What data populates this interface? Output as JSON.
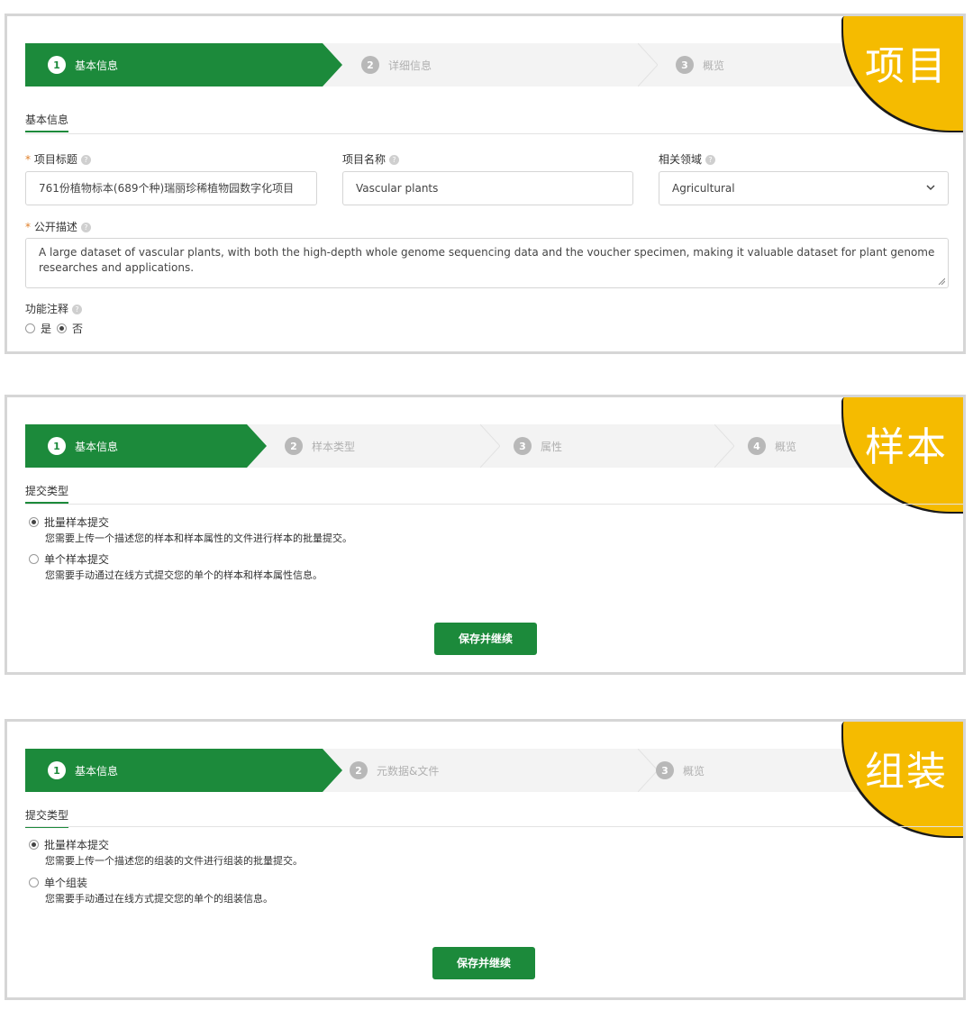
{
  "project": {
    "badge": "项目",
    "steps": [
      {
        "num": "1",
        "label": "基本信息"
      },
      {
        "num": "2",
        "label": "详细信息"
      },
      {
        "num": "3",
        "label": "概览"
      }
    ],
    "section_tab": "基本信息",
    "fields": {
      "title_label": "项目标题",
      "title_value": "761份植物标本(689个种)瑞丽珍稀植物园数字化项目",
      "name_label": "项目名称",
      "name_value": "Vascular plants",
      "domain_label": "相关领域",
      "domain_value": "Agricultural",
      "desc_label": "公开描述",
      "desc_value": "A large dataset of vascular plants, with both the high-depth whole genome sequencing data and the voucher specimen, making it valuable dataset for plant genome researches and applications.",
      "annotation_label": "功能注释",
      "annotation_yes": "是",
      "annotation_no": "否"
    }
  },
  "sample": {
    "badge": "样本",
    "steps": [
      {
        "num": "1",
        "label": "基本信息"
      },
      {
        "num": "2",
        "label": "样本类型"
      },
      {
        "num": "3",
        "label": "属性"
      },
      {
        "num": "4",
        "label": "概览"
      }
    ],
    "section_tab": "提交类型",
    "options": [
      {
        "title": "批量样本提交",
        "desc": "您需要上传一个描述您的样本和样本属性的文件进行样本的批量提交。",
        "selected": true
      },
      {
        "title": "单个样本提交",
        "desc": "您需要手动通过在线方式提交您的单个的样本和样本属性信息。",
        "selected": false
      }
    ],
    "button": "保存并继续"
  },
  "assembly": {
    "badge": "组装",
    "steps": [
      {
        "num": "1",
        "label": "基本信息"
      },
      {
        "num": "2",
        "label": "元数据&文件"
      },
      {
        "num": "3",
        "label": "概览"
      }
    ],
    "section_tab": "提交类型",
    "options": [
      {
        "title": "批量样本提交",
        "desc": "您需要上传一个描述您的组装的文件进行组装的批量提交。",
        "selected": true
      },
      {
        "title": "单个组装",
        "desc": "您需要手动通过在线方式提交您的单个的组装信息。",
        "selected": false
      }
    ],
    "button": "保存并继续"
  },
  "colors": {
    "accent": "#1c8a3b",
    "badge": "#f5bb00",
    "required": "#e0802a"
  }
}
